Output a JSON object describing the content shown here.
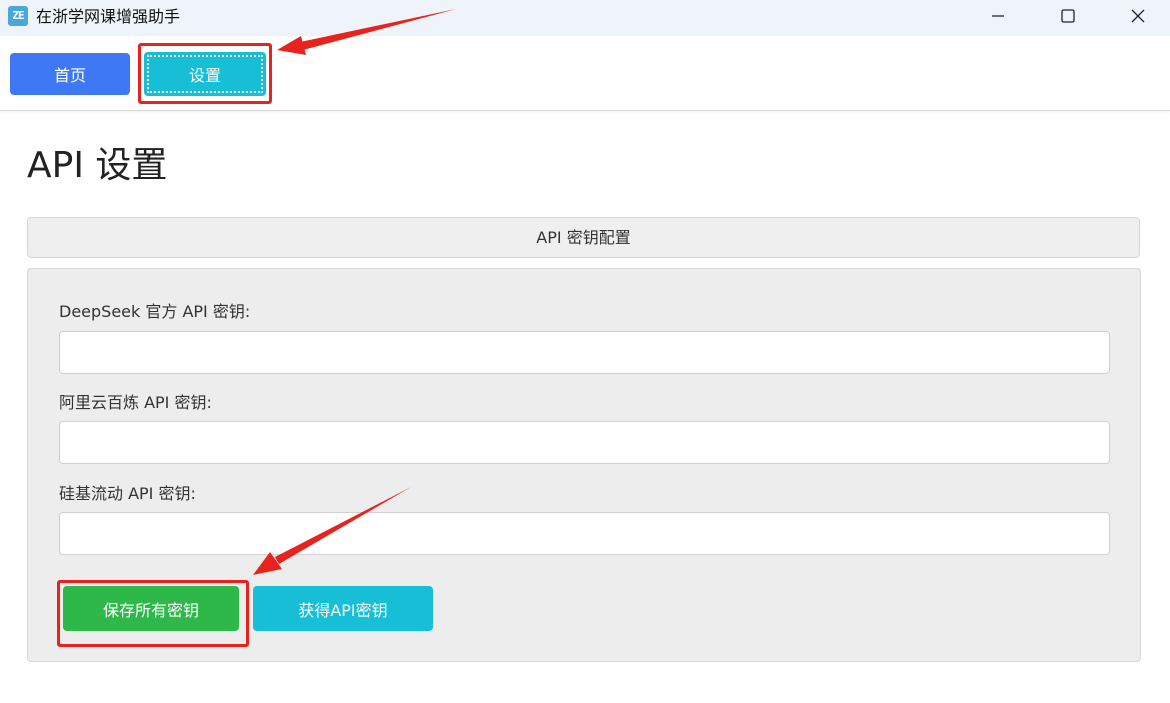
{
  "window": {
    "title": "在浙学网课增强助手",
    "icon_text": "ZE",
    "icon_color": "#4aa8d8",
    "controls": [
      "minimize-icon",
      "maximize-icon",
      "close-icon"
    ]
  },
  "nav": {
    "home_label": "首页",
    "settings_label": "设置",
    "home_color": "#3f78f5",
    "settings_color": "#17bfd6",
    "active": "settings"
  },
  "page": {
    "title": "API 设置"
  },
  "section": {
    "header": "API 密钥配置",
    "fields": [
      {
        "label": "DeepSeek 官方 API 密钥:",
        "value": "",
        "placeholder": ""
      },
      {
        "label": "阿里云百炼 API 密钥:",
        "value": "",
        "placeholder": ""
      },
      {
        "label": "硅基流动 API 密钥:",
        "value": "",
        "placeholder": ""
      }
    ],
    "save_button": "保存所有密钥",
    "get_button": "获得API密钥",
    "save_color": "#2fb84a",
    "get_color": "#17bfd6"
  },
  "annotations": {
    "highlight_color": "#e8221c"
  }
}
